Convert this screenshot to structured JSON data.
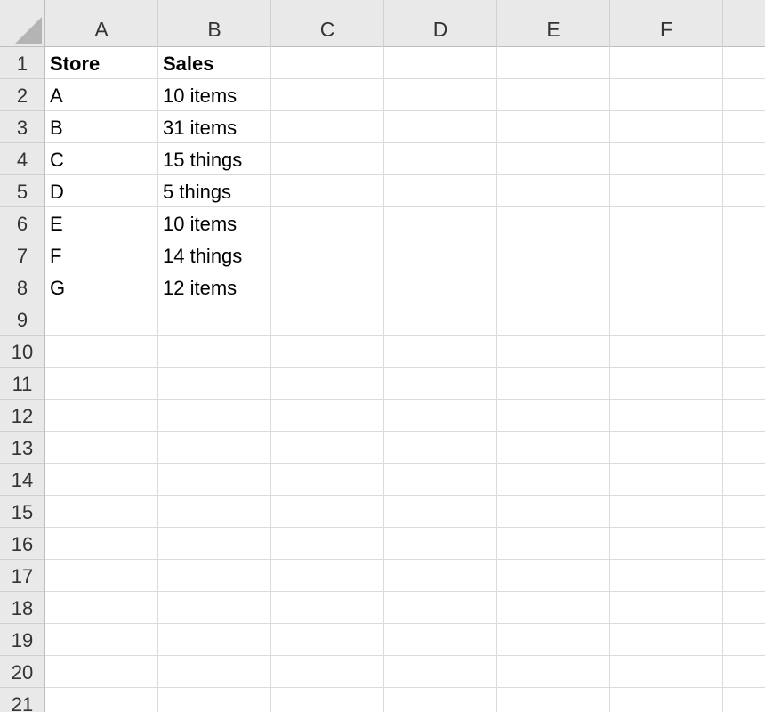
{
  "columns": [
    "A",
    "B",
    "C",
    "D",
    "E",
    "F"
  ],
  "rows": [
    "1",
    "2",
    "3",
    "4",
    "5",
    "6",
    "7",
    "8",
    "9",
    "10",
    "11",
    "12",
    "13",
    "14",
    "15",
    "16",
    "17",
    "18",
    "19",
    "20",
    "21"
  ],
  "cells": {
    "A1": "Store",
    "B1": "Sales",
    "A2": "A",
    "B2": "10 items",
    "A3": "B",
    "B3": "31 items",
    "A4": "C",
    "B4": "15 things",
    "A5": "D",
    "B5": "5 things",
    "A6": "E",
    "B6": "10 items",
    "A7": "F",
    "B7": "14 things",
    "A8": "G",
    "B8": "12 items"
  },
  "bold_cells": [
    "A1",
    "B1"
  ],
  "colors": {
    "header_bg": "#e9e9e9",
    "gridline": "#dadada",
    "header_border": "#bdbdbd"
  }
}
